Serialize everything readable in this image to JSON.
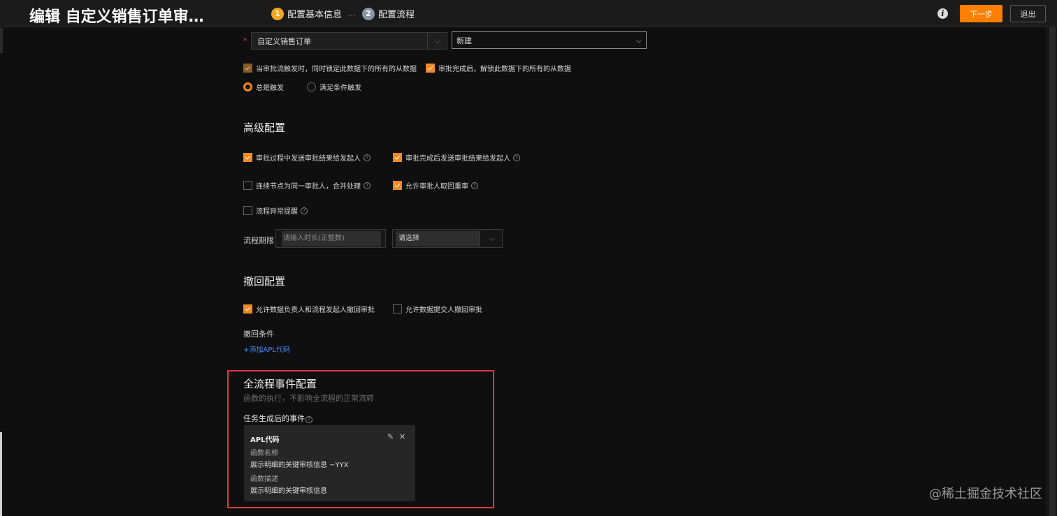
{
  "header": {
    "title": "编辑 自定义销售订单审…",
    "steps": [
      {
        "num": "1",
        "label": "配置基本信息"
      },
      {
        "num": "2",
        "label": "配置流程"
      }
    ],
    "step_separator": "…",
    "info_icon": "i",
    "next_label": "下一步",
    "exit_label": "退出"
  },
  "trigger": {
    "required_mark": "*",
    "object_value": "自定义销售订单",
    "event_value": "新建",
    "lock_on_trigger": {
      "label": "当审批流触发时，同时锁定此数据下的所有的从数据",
      "checked": true
    },
    "unlock_on_complete": {
      "label": "审批完成后，解锁此数据下的所有的从数据",
      "checked": true
    },
    "radio_always": {
      "label": "总是触发",
      "selected": true
    },
    "radio_condition": {
      "label": "满足条件触发",
      "selected": false
    }
  },
  "advanced": {
    "title": "高级配置",
    "options": [
      {
        "label": "审批过程中发送审批结果给发起人",
        "checked": true
      },
      {
        "label": "审批完成后发送审批结果给发起人",
        "checked": true
      },
      {
        "label": "连续节点为同一审批人，合并处理",
        "checked": false
      },
      {
        "label": "允许审批人取回重审",
        "checked": true
      },
      {
        "label": "流程异常提醒",
        "checked": false
      }
    ],
    "deadline_label": "流程期限",
    "deadline_placeholder": "请输入时长(正整数)",
    "unit_value": "请选择"
  },
  "recall": {
    "title": "撤回配置",
    "options": [
      {
        "label": "允许数据负责人和流程发起人撤回审批",
        "checked": true
      },
      {
        "label": "允许数据提交人撤回审批",
        "checked": false
      }
    ],
    "condition_label": "撤回条件",
    "add_apl_link": "+添加APL代码"
  },
  "events": {
    "title": "全流程事件配置",
    "subtitle": "函数的执行，不影响全流程的正常流转",
    "task_event_label": "任务生成后的事件",
    "card": {
      "title": "APL代码",
      "name_key": "函数名称",
      "name_value": "展示明细的关键审核信息 ~YYX",
      "desc_key": "函数描述",
      "desc_value": "展示明细的关键审核信息"
    }
  },
  "watermark": "@稀土掘金技术社区",
  "colors": {
    "accent": "#ff8000",
    "checkbox": "#f08a24",
    "link": "#4a8ff7",
    "highlight": "#e0393d",
    "step2": "#8a93a6"
  },
  "icons": [
    "info-icon",
    "chevron-down-icon",
    "help-icon",
    "edit-icon",
    "close-icon"
  ]
}
